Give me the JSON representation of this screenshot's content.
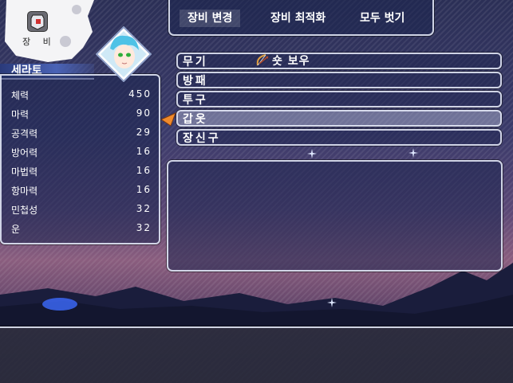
{
  "menu": {
    "label": "장 비",
    "icon": "equipment-menu-icon"
  },
  "tabs": [
    {
      "label": "장비 변경",
      "active": true
    },
    {
      "label": "장비 최적화",
      "active": false
    },
    {
      "label": "모두 벗기",
      "active": false
    }
  ],
  "character": {
    "name": "세라토",
    "portrait_icon": "character-portrait",
    "stats": [
      {
        "label": "체력",
        "value": "450"
      },
      {
        "label": "마력",
        "value": "90"
      },
      {
        "label": "공격력",
        "value": "29"
      },
      {
        "label": "방어력",
        "value": "16"
      },
      {
        "label": "마법력",
        "value": "16"
      },
      {
        "label": "항마력",
        "value": "16"
      },
      {
        "label": "민첩성",
        "value": "32"
      },
      {
        "label": "운",
        "value": "32"
      }
    ]
  },
  "slots": [
    {
      "label": "무기",
      "item": "숏 보우",
      "item_icon": "bow-icon",
      "selected": false
    },
    {
      "label": "방패",
      "item": "",
      "selected": false
    },
    {
      "label": "투구",
      "item": "",
      "selected": false
    },
    {
      "label": "갑옷",
      "item": "",
      "selected": true
    },
    {
      "label": "장신구",
      "item": "",
      "selected": false
    }
  ],
  "info": {
    "description": ""
  },
  "help": {
    "text": ""
  },
  "colors": {
    "panel_border": "#e1e6f5",
    "cursor": "#f08a2c",
    "panel_fill": "#1c244e"
  }
}
